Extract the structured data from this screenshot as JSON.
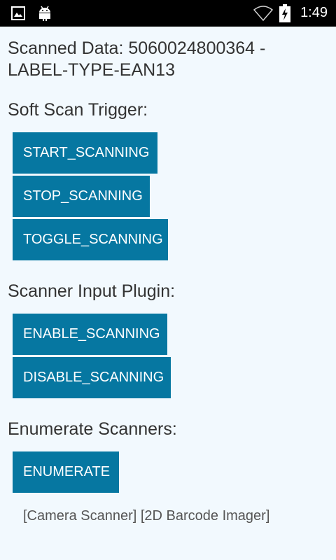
{
  "status_bar": {
    "time": "1:49",
    "icons": [
      "image-icon",
      "android-icon",
      "wifi-icon",
      "battery-charging-icon"
    ]
  },
  "scanned": {
    "label": "Scanned Data: 5060024800364 - LABEL-TYPE-EAN13"
  },
  "soft_scan": {
    "heading": "Soft Scan Trigger:",
    "buttons": [
      "START_SCANNING",
      "STOP_SCANNING",
      "TOGGLE_SCANNING"
    ]
  },
  "scanner_plugin": {
    "heading": "Scanner Input Plugin:",
    "buttons": [
      "ENABLE_SCANNING",
      "DISABLE_SCANNING"
    ]
  },
  "enumerate": {
    "heading": "Enumerate Scanners:",
    "button": "ENUMERATE",
    "result": "[Camera Scanner] [2D Barcode Imager]"
  },
  "colors": {
    "button": "#0677a1",
    "background": "#f2f9fe",
    "status_bar": "#000000"
  }
}
